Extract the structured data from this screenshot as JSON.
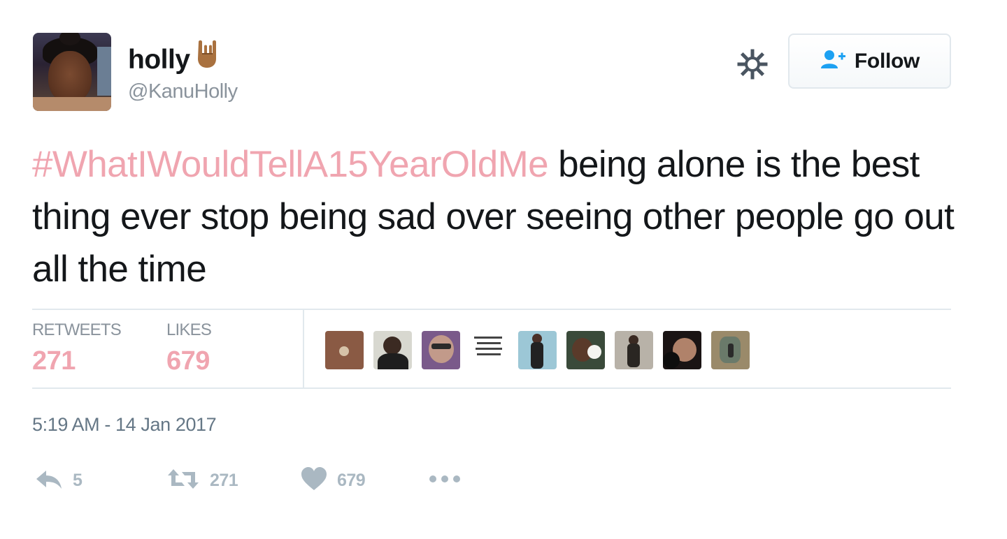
{
  "user": {
    "display_name": "holly",
    "display_emoji": "sign-of-horns-emoji",
    "handle": "@KanuHolly"
  },
  "header": {
    "settings_icon": "gear-icon",
    "follow_label": "Follow",
    "follow_icon": "add-user-icon"
  },
  "tweet": {
    "hashtag": "#WhatIWouldTellA15YearOldMe",
    "text": " being alone is the best thing ever stop being sad over seeing other people go out all the time"
  },
  "stats": {
    "retweets_label": "RETWEETS",
    "retweets_value": "271",
    "likes_label": "LIKES",
    "likes_value": "679"
  },
  "likers_count_shown": 9,
  "timestamp": "5:19 AM - 14 Jan 2017",
  "actions": {
    "reply_icon": "reply-icon",
    "reply_count": "5",
    "retweet_icon": "retweet-icon",
    "retweet_count": "271",
    "like_icon": "heart-icon",
    "like_count": "679",
    "more_icon": "more-dots-icon"
  },
  "colors": {
    "hashtag": "#f0a5b0",
    "stat_value": "#f0a5b0",
    "follow_icon": "#1da1f2",
    "muted": "#8a939c",
    "action_icon": "#aab8c2"
  }
}
